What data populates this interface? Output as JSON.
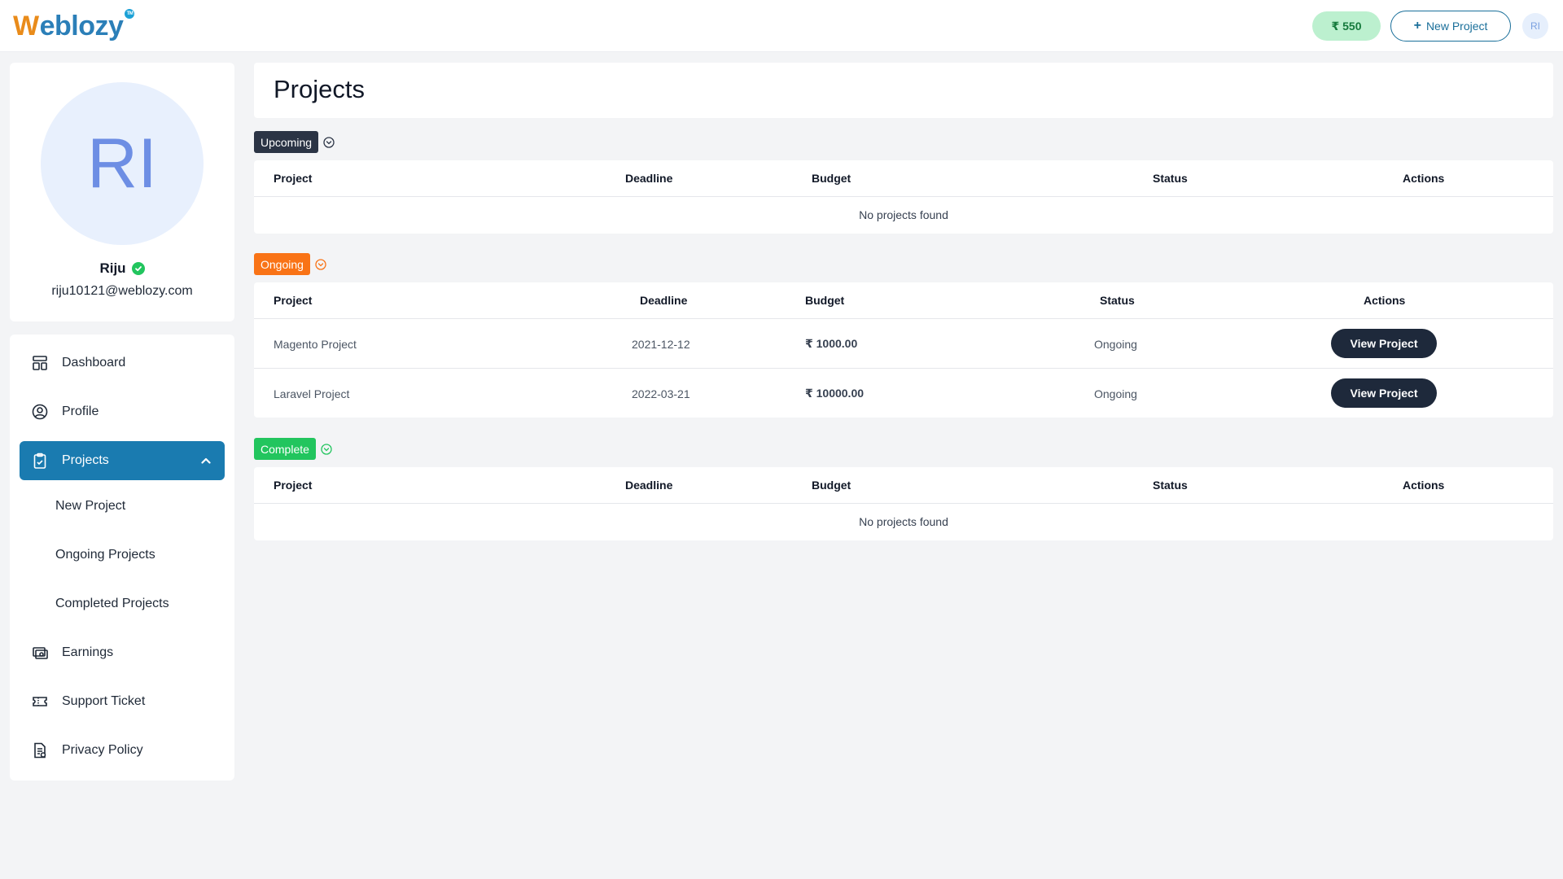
{
  "header": {
    "logo_first": "W",
    "logo_rest": "eblozy",
    "logo_mark": "TM",
    "balance": "₹ 550",
    "new_project_label": "New Project",
    "avatar_initials": "RI"
  },
  "profile": {
    "initials": "RI",
    "name": "Riju",
    "email": "riju10121@weblozy.com"
  },
  "sidebar": {
    "items": [
      {
        "label": "Dashboard",
        "icon": "dashboard-icon"
      },
      {
        "label": "Profile",
        "icon": "user-circle-icon"
      },
      {
        "label": "Projects",
        "icon": "clipboard-icon",
        "active": true
      },
      {
        "label": "Earnings",
        "icon": "cash-icon"
      },
      {
        "label": "Support Ticket",
        "icon": "ticket-icon"
      },
      {
        "label": "Privacy Policy",
        "icon": "document-icon"
      }
    ],
    "sub_items": [
      "New Project",
      "Ongoing Projects",
      "Completed Projects"
    ]
  },
  "main": {
    "title": "Projects",
    "columns": [
      "Project",
      "Deadline",
      "Budget",
      "Status",
      "Actions"
    ],
    "empty_text": "No projects found",
    "sections": {
      "upcoming": {
        "label": "Upcoming",
        "color": "#2b3445",
        "rows": []
      },
      "ongoing": {
        "label": "Ongoing",
        "color": "#f97316",
        "rows": [
          {
            "project": "Magento Project",
            "deadline": "2021-12-12",
            "budget": "₹ 1000.00",
            "status": "Ongoing",
            "action": "View Project"
          },
          {
            "project": "Laravel Project",
            "deadline": "2022-03-21",
            "budget": "₹ 10000.00",
            "status": "Ongoing",
            "action": "View Project"
          }
        ]
      },
      "complete": {
        "label": "Complete",
        "color": "#22c55e",
        "rows": []
      }
    }
  },
  "colors": {
    "accent": "#1a7bb0",
    "dark_button": "#1e293b",
    "balance_bg": "#bcf0cf"
  }
}
